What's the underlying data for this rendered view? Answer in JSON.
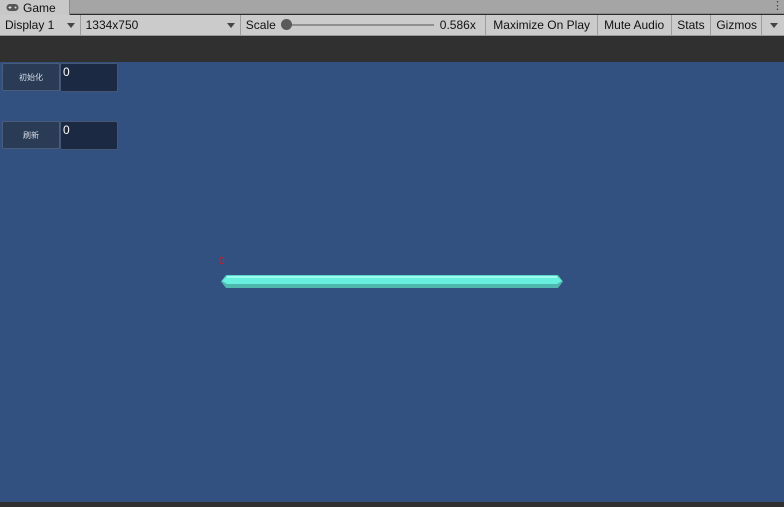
{
  "window": {
    "tab_label": "Game",
    "tab_icon": "gamepad-icon"
  },
  "toolbar": {
    "display": "Display 1",
    "resolution": "1334x750",
    "scale_label": "Scale",
    "scale_value": "0.586x",
    "scale_fraction": 0.0,
    "maximize_on_play": "Maximize On Play",
    "mute_audio": "Mute Audio",
    "stats": "Stats",
    "gizmos": "Gizmos"
  },
  "game": {
    "init_button": "初始化",
    "init_value": "0",
    "refresh_button": "刷新",
    "refresh_value": "0",
    "bar_label": "0",
    "bar_fill_fraction": 1.0,
    "colors": {
      "background": "#325080",
      "bar": "#5ce8d6",
      "bar_label": "#e01818"
    }
  }
}
